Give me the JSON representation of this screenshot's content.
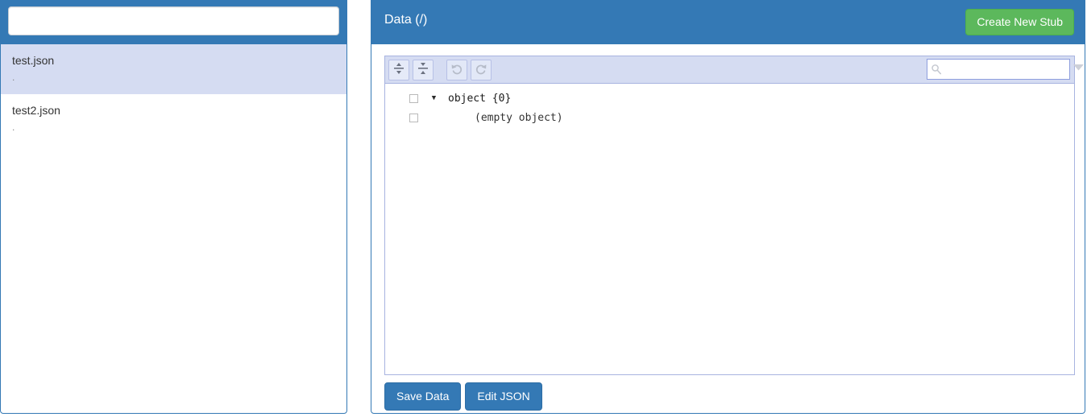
{
  "file_browser": {
    "search": {
      "value": "",
      "placeholder": ""
    },
    "items": [
      {
        "name": "test.json",
        "subtitle": ".",
        "selected": true
      },
      {
        "name": "test2.json",
        "subtitle": ".",
        "selected": false
      }
    ]
  },
  "data_panel": {
    "title": "Data (/)",
    "create_stub_label": "Create New Stub",
    "footer": {
      "save_label": "Save Data",
      "edit_json_label": "Edit JSON"
    }
  },
  "json_editor": {
    "toolbar": {
      "expand_all": "expand-all-icon",
      "collapse_all": "collapse-all-icon",
      "undo": "undo-icon",
      "redo": "redo-icon"
    },
    "search": {
      "value": "",
      "placeholder": "",
      "icon": "search-icon"
    },
    "tree": [
      {
        "label": "object {0}",
        "expandable": true,
        "expanded": true
      },
      {
        "label": "(empty object)",
        "expandable": false,
        "expanded": false
      }
    ]
  },
  "colors": {
    "header_blue": "#3479b5",
    "accent_green": "#5cb85c",
    "selection_lavender": "#d5dcf2",
    "editor_border": "#a8b4e0"
  }
}
